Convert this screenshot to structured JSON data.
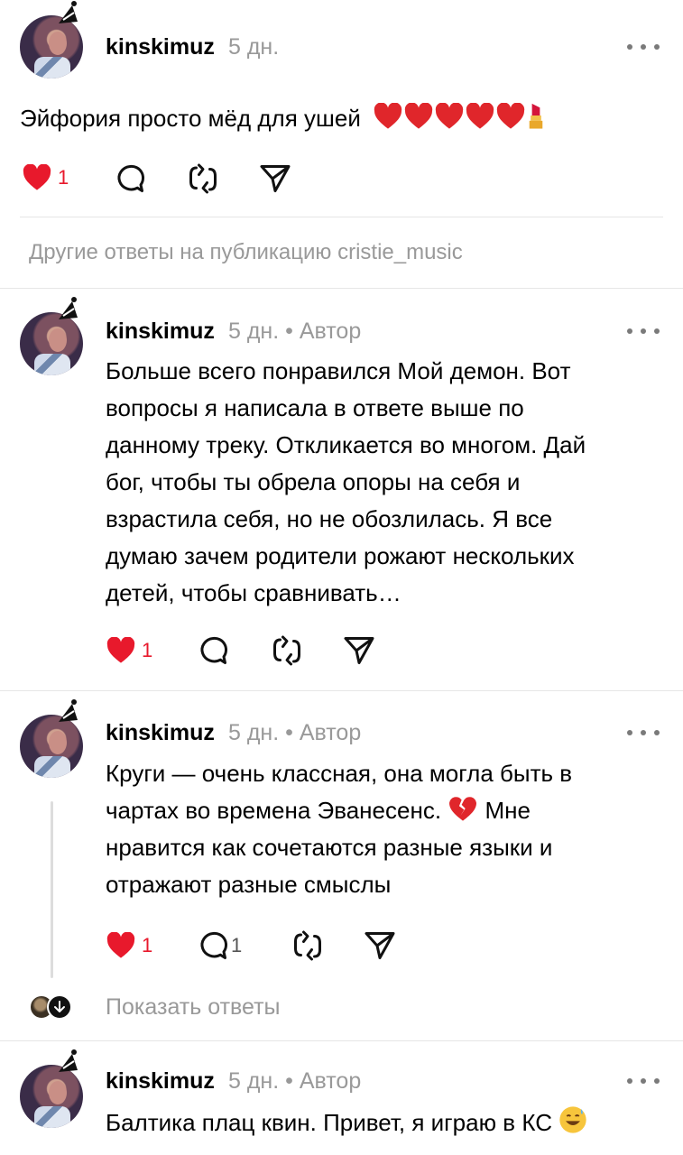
{
  "posts": [
    {
      "username": "kinskimuz",
      "time": "5 дн.",
      "text": "Эйфория просто мёд для ушей",
      "emojis": [
        "heart",
        "heart",
        "heart",
        "heart",
        "heart",
        "lipstick"
      ],
      "likes": "1",
      "liked": true,
      "comments": "",
      "icons": [
        "heart-icon",
        "comment-icon",
        "repost-icon",
        "share-icon"
      ]
    }
  ],
  "section_header": "Другие ответы на публикацию cristie_music",
  "replies": [
    {
      "username": "kinskimuz",
      "meta": "5 дн. • Автор",
      "lines": [
        "Больше всего понравился Мой демон. Вот",
        "вопросы я написала в ответе выше по",
        "данному треку. Откликается во многом. Дай",
        "бог, чтобы ты обрела опоры на себя и",
        "взрастила себя, но не обозлилась. Я все",
        "думаю зачем родители рожают нескольких",
        "детей, чтобы сравнивать…"
      ],
      "likes": "1",
      "comments": ""
    },
    {
      "username": "kinskimuz",
      "meta": "5 дн. • Автор",
      "lines": [
        "Круги — очень классная, она могла быть в",
        "чартах во времена Эванесенс.",
        "нравится как сочетаются разные языки и",
        "отражают разные смыслы"
      ],
      "line2_suffix": "Мне",
      "likes": "1",
      "comments": "1",
      "show_replies": "Показать ответы"
    },
    {
      "username": "kinskimuz",
      "meta": "5 дн. • Автор",
      "lines": [
        "Балтика плац квин. Привет, я играю в КС"
      ]
    }
  ],
  "colors": {
    "liked_red": "#e8192c",
    "muted": "#999999",
    "divider": "#e6e6e6"
  }
}
